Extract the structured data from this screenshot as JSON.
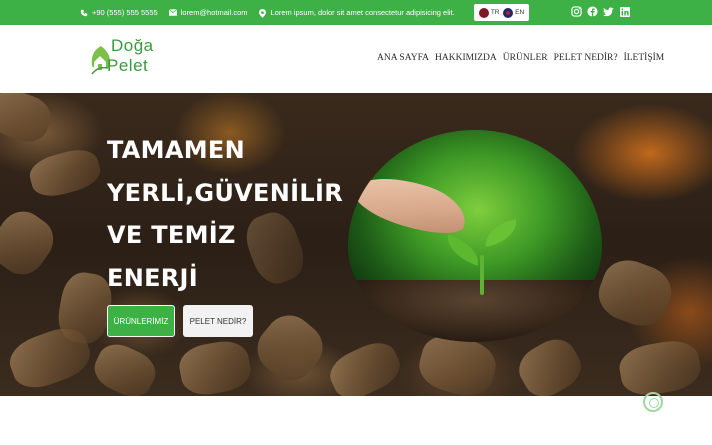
{
  "topbar": {
    "phone": "+90 (555) 555 5555",
    "email": "lorem@hotmail.com",
    "address": "Lorem ipsum, dolor sit amet consectetur adipisicing elit.",
    "languages": [
      {
        "code": "TR",
        "icon": "turkey-flag-icon"
      },
      {
        "code": "EN",
        "icon": "uk-flag-icon"
      }
    ],
    "socials": [
      "instagram-icon",
      "facebook-icon",
      "twitter-icon",
      "linkedin-icon"
    ],
    "bg_color": "#3db146"
  },
  "header": {
    "logo": {
      "line1": "Doğa",
      "line2": "Pelet"
    },
    "nav": [
      "ANA SAYFA",
      "HAKKIMIZDA",
      "ÜRÜNLER",
      "PELET NEDİR?",
      "İLETİŞİM"
    ]
  },
  "hero": {
    "title_lines": [
      "TAMAMEN",
      "YERLİ,GÜVENİLİR",
      "VE TEMİZ",
      "ENERJİ"
    ],
    "primary_button": "ÜRÜNLERİMİZ",
    "secondary_button": "PELET NEDİR?",
    "accent_color": "#3db146"
  }
}
